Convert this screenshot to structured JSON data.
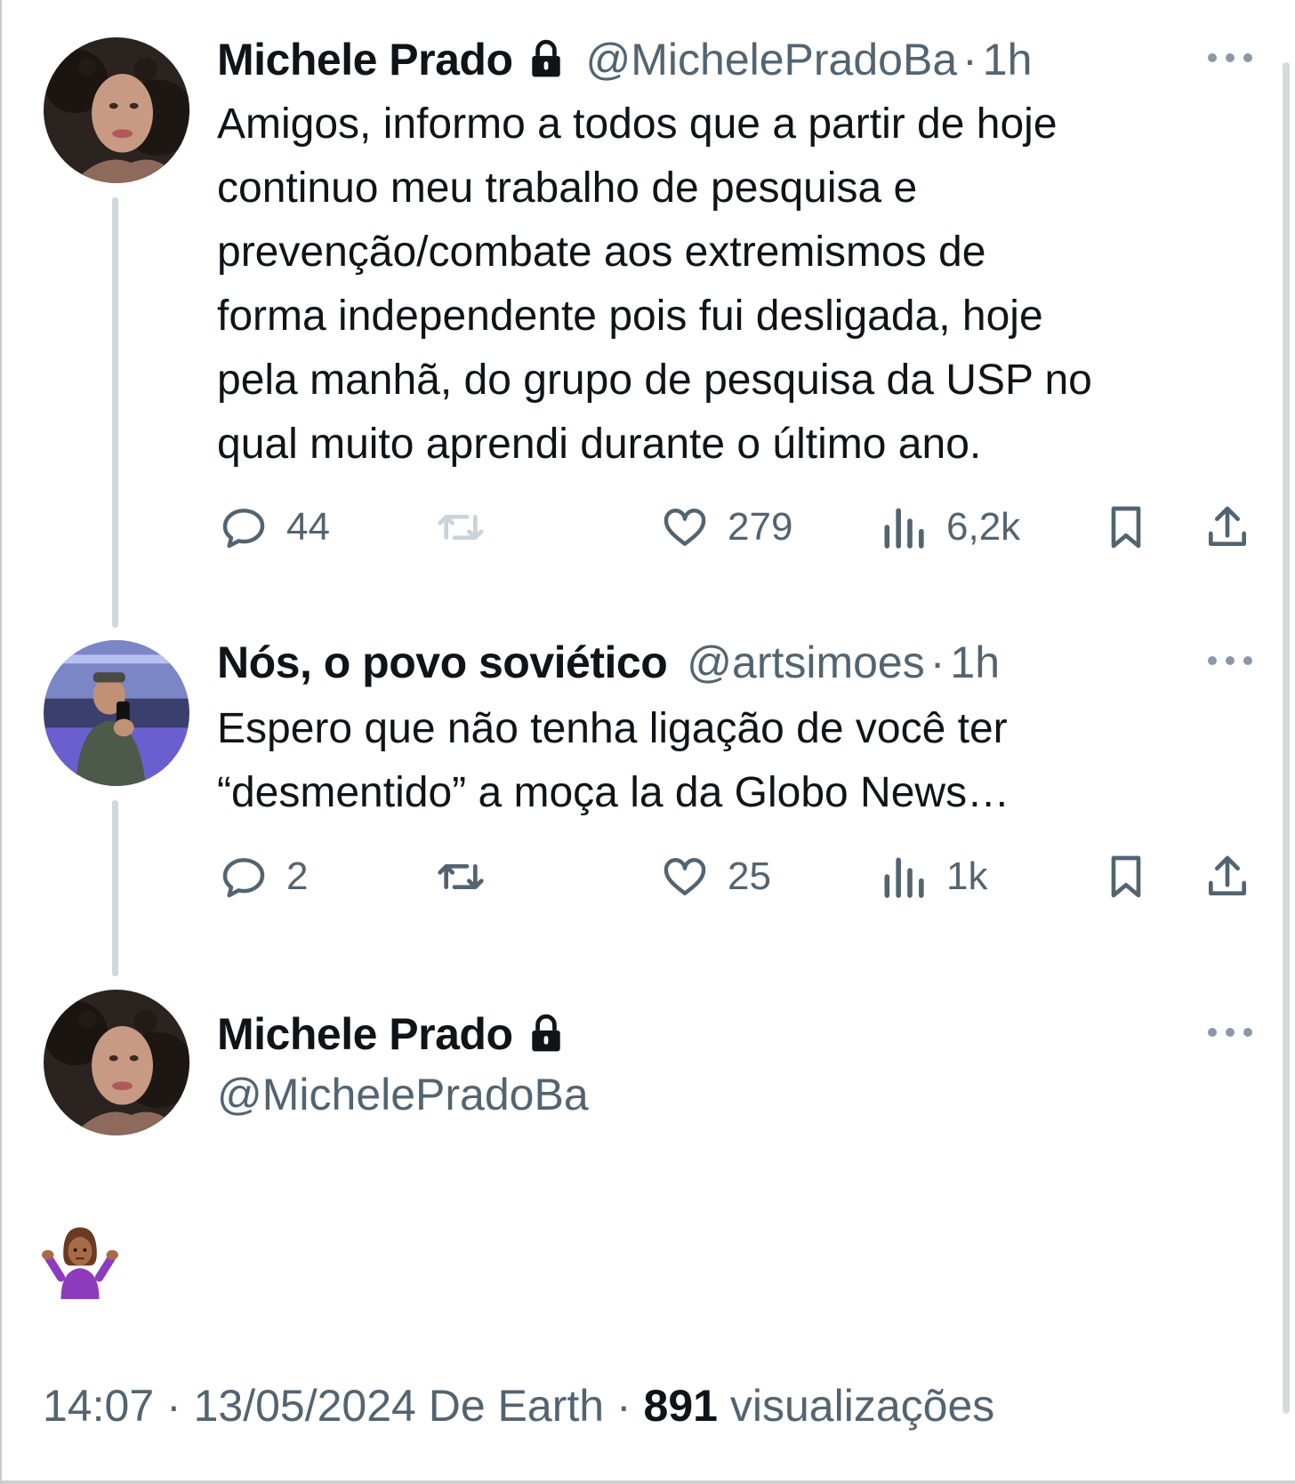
{
  "tweets": [
    {
      "name": "Michele Prado",
      "handle": "@MichelePradoBa",
      "separator": "·",
      "time": "1h",
      "text": "Amigos, informo a todos que a partir de hoje\ncontinuo meu trabalho de pesquisa e\nprevenção/combate aos extremismos de\nforma independente pois fui desligada, hoje\npela manhã, do grupo de pesquisa da USP no\nqual muito aprendi durante o último ano.",
      "replies": "44",
      "retweets": "",
      "likes": "279",
      "views": "6,2k"
    },
    {
      "name": "Nós, o povo soviético",
      "handle": "@artsimoes",
      "separator": "·",
      "time": "1h",
      "text": "Espero que não tenha ligação de você ter\n“desmentido” a moça la da Globo News…",
      "replies": "2",
      "retweets": "",
      "likes": "25",
      "views": "1k"
    }
  ],
  "main_tweet": {
    "name": "Michele Prado",
    "handle": "@MichelePradoBa",
    "emoji": "person-shrugging-emoji"
  },
  "footer": {
    "time": "14:07",
    "sep1": "·",
    "date": "13/05/2024",
    "source": "De Earth",
    "sep2": "·",
    "views_count": "891",
    "views_label": "visualizações"
  },
  "icons": {
    "reply": "reply-icon",
    "retweet": "retweet-icon",
    "like": "heart-icon",
    "views": "views-bar-icon",
    "bookmark": "bookmark-icon",
    "share": "share-icon",
    "lock": "lock-icon",
    "more": "more-dots-icon"
  },
  "colors": {
    "text": "#0f1419",
    "secondary": "#536471",
    "thread_line": "#cfd9de",
    "faded_icon": "#c9d3da"
  }
}
